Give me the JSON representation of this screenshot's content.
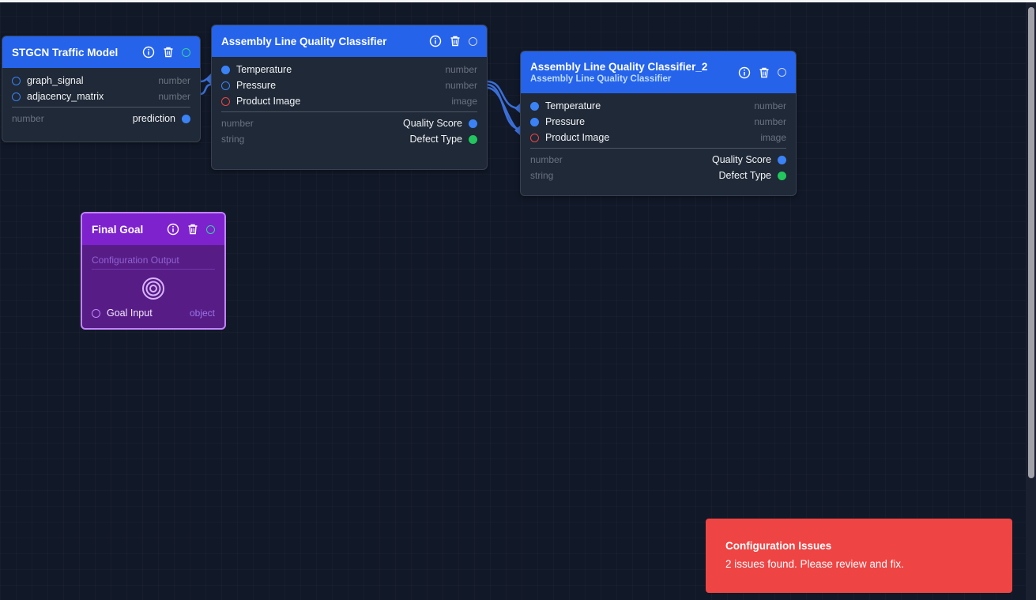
{
  "colors": {
    "canvas_bg": "#111827",
    "node_header": "#2563eb",
    "goal_header": "#7e22ce",
    "toast_bg": "#ef4444",
    "port_blue": "#3b82f6",
    "port_green": "#22c55e",
    "port_red": "#ef4444"
  },
  "nodes": [
    {
      "title": "STGCN Traffic Model",
      "subtitle": "",
      "icons": [
        "info-icon",
        "trash-icon",
        "status-dot-icon"
      ],
      "inputs": [
        {
          "name": "graph_signal",
          "type": "number"
        },
        {
          "name": "adjacency_matrix",
          "type": "number"
        }
      ],
      "outputs": [
        {
          "type": "number",
          "name": "prediction"
        }
      ]
    },
    {
      "title": "Assembly Line Quality Classifier",
      "subtitle": "",
      "icons": [
        "info-icon",
        "trash-icon",
        "status-dot-icon"
      ],
      "inputs": [
        {
          "name": "Temperature",
          "type": "number"
        },
        {
          "name": "Pressure",
          "type": "number"
        },
        {
          "name": "Product Image",
          "type": "image"
        }
      ],
      "outputs": [
        {
          "type": "number",
          "name": "Quality Score"
        },
        {
          "type": "string",
          "name": "Defect Type"
        }
      ]
    },
    {
      "title": "Assembly Line Quality Classifier_2",
      "subtitle": "Assembly Line Quality Classifier",
      "icons": [
        "info-icon",
        "trash-icon",
        "status-dot-icon"
      ],
      "inputs": [
        {
          "name": "Temperature",
          "type": "number"
        },
        {
          "name": "Pressure",
          "type": "number"
        },
        {
          "name": "Product Image",
          "type": "image"
        }
      ],
      "outputs": [
        {
          "type": "number",
          "name": "Quality Score"
        },
        {
          "type": "string",
          "name": "Defect Type"
        }
      ]
    }
  ],
  "goal": {
    "title": "Final Goal",
    "config_label": "Configuration Output",
    "icon": "target-icon",
    "input": {
      "name": "Goal Input",
      "type": "object"
    }
  },
  "toast": {
    "title": "Configuration Issues",
    "message": "2 issues found. Please review and fix."
  }
}
